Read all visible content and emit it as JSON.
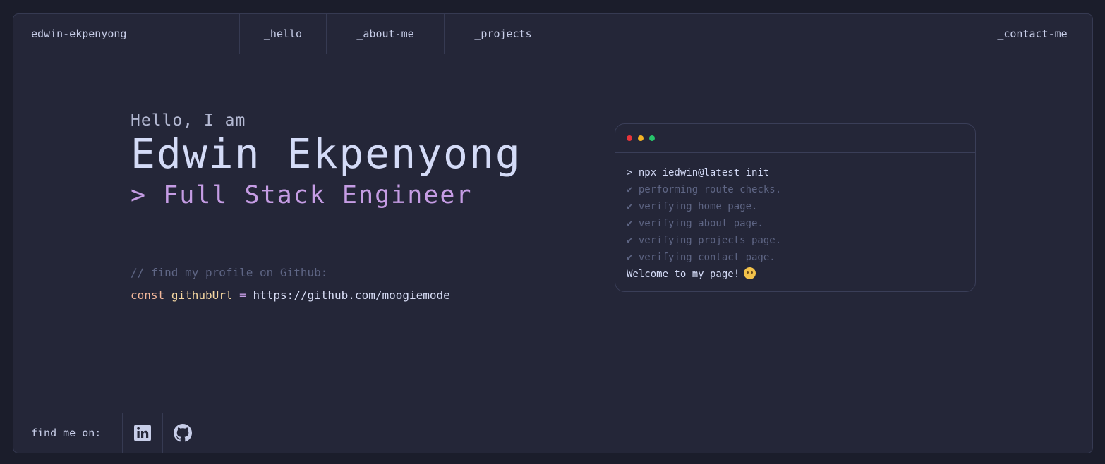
{
  "nav": {
    "brand": "edwin-ekpenyong",
    "tabs": [
      "_hello",
      "_about-me",
      "_projects"
    ],
    "contact": "_contact-me"
  },
  "hero": {
    "greeting": "Hello, I am",
    "name": "Edwin Ekpenyong",
    "role": "> Full Stack Engineer"
  },
  "code": {
    "comment": "// find my profile on Github:",
    "keyword": "const",
    "variable": "githubUrl",
    "operator": "=",
    "value": "https://github.com/moogiemode"
  },
  "terminal": {
    "dots": [
      "#e8343a",
      "#f4b424",
      "#27c46b"
    ],
    "command": "> npx iedwin@latest init",
    "checks": [
      "✔ performing route checks.",
      "✔ verifying home page.",
      "✔ verifying about page.",
      "✔ verifying projects page.",
      "✔ verifying contact page."
    ],
    "welcome": "Welcome to my page!"
  },
  "footer": {
    "label": "find me on:",
    "icons": [
      "linkedin-icon",
      "github-icon"
    ]
  },
  "colors": {
    "background": "#1b1d2b",
    "panel": "#242638",
    "accent": "#c59ce4",
    "text": "#c7cde8"
  }
}
